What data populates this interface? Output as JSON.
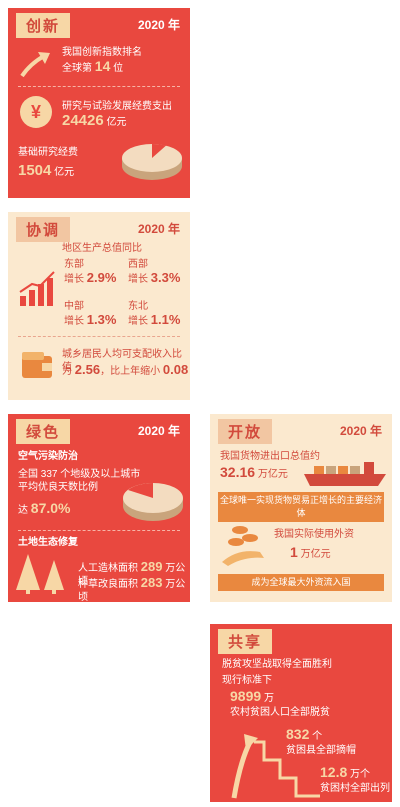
{
  "innovation": {
    "tag": "创新",
    "year": "2020 年",
    "rank_line1": "我国创新指数排名",
    "rank_pre": "全球第",
    "rank_num": "14",
    "rank_post": "位",
    "rd_label": "研究与试验发展经费支出",
    "rd_value": "24426",
    "rd_unit": "亿元",
    "basic_label": "基础研究经费",
    "basic_value": "1504",
    "basic_unit": "亿元",
    "yen_glyph": "¥",
    "colors": {
      "card": "#e9483f",
      "accent": "#f7d7a6"
    }
  },
  "coordination": {
    "tag": "协调",
    "year": "2020 年",
    "gdp_title": "地区生产总值同比",
    "regions": [
      {
        "name": "东部",
        "growth_label": "增长",
        "value": "2.9%"
      },
      {
        "name": "西部",
        "growth_label": "增长",
        "value": "3.3%"
      },
      {
        "name": "中部",
        "growth_label": "增长",
        "value": "1.3%"
      },
      {
        "name": "东北",
        "growth_label": "增长",
        "value": "1.1%"
      }
    ],
    "income_line1": "城乡居民人均可支配收入比值",
    "income_pre": "为",
    "income_ratio": "2.56",
    "income_mid": "，比上年缩小",
    "income_change": "0.08",
    "colors": {
      "card": "#fbe9cf",
      "text": "#d24a3c"
    }
  },
  "green": {
    "tag": "绿色",
    "year": "2020 年",
    "air_title": "空气污染防治",
    "air_line1": "全国 337 个地级及以上城市",
    "air_line2": "平均优良天数比例",
    "air_pre": "达",
    "air_value": "87.0%",
    "land_title": "土地生态修复",
    "afforest_label": "人工造林面积",
    "afforest_value": "289",
    "afforest_unit": "万公顷",
    "grass_label": "种草改良面积",
    "grass_value": "283",
    "grass_unit": "万公顷",
    "colors": {
      "card": "#e9483f"
    }
  },
  "opening": {
    "tag": "开放",
    "year": "2020 年",
    "trade_title": "我国货物进出口总值约",
    "trade_value": "32.16",
    "trade_unit": "万亿元",
    "trade_banner": "全球唯一实现货物贸易正增长的主要经济体",
    "fdi_title": "我国实际使用外资",
    "fdi_value": "1",
    "fdi_unit": "万亿元",
    "fdi_banner": "成为全球最大外资流入国",
    "colors": {
      "card": "#fbe9cf"
    }
  },
  "sharing": {
    "tag": "共享",
    "title_line1": "脱贫攻坚战取得全面胜利",
    "title_line2": "现行标准下",
    "people_value": "9899",
    "people_unit": "万",
    "people_label": "农村贫困人口全部脱贫",
    "county_value": "832",
    "county_unit": "个",
    "county_label": "贫困县全部摘帽",
    "village_value": "12.8",
    "village_unit": "万个",
    "village_label": "贫困村全部出列",
    "colors": {
      "card": "#e9483f"
    }
  }
}
